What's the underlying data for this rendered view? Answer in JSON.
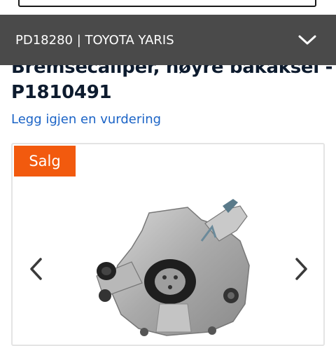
{
  "vehicle_bar": {
    "text": "PD18280 | TOYOTA YARIS",
    "toggle_icon": "chevron-down-icon"
  },
  "product": {
    "title": "Bremsecaliper, høyre bakaksel - P1810491",
    "review_link": "Legg igjen en vurdering",
    "badge": "Salg"
  },
  "gallery": {
    "prev_icon": "chevron-left-icon",
    "next_icon": "chevron-right-icon"
  },
  "colors": {
    "vehicle_bar_bg": "#4a4a4a",
    "badge_bg": "#f25a0e",
    "link": "#1a63c6",
    "title": "#0d1b2e"
  }
}
